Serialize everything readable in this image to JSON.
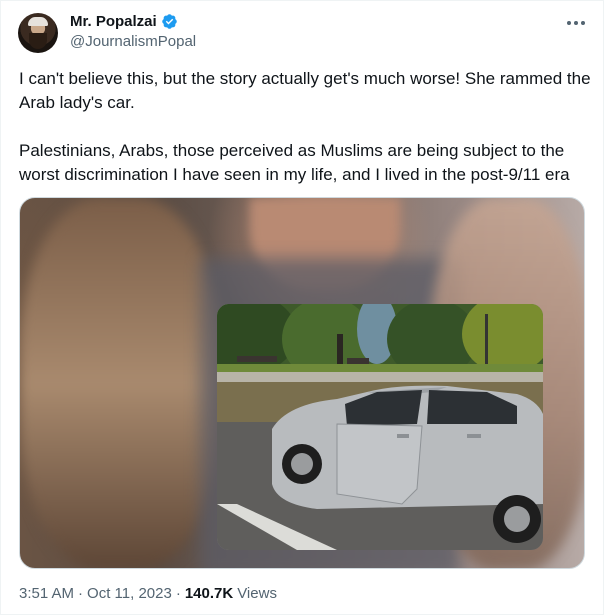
{
  "author": {
    "display_name": "Mr. Popalzai",
    "handle": "@JournalismPopal",
    "verified": true
  },
  "tweet": {
    "paragraphs": [
      "I can't believe this, but the story actually get's much worse! She rammed the Arab lady's car.",
      "Palestinians, Arabs, those perceived as Muslims are being subject to the worst discrimination I have seen in my life, and I lived in the post-9/11 era"
    ]
  },
  "meta": {
    "time": "3:51 AM",
    "separator": "·",
    "date": "Oct 11, 2023",
    "views_count": "140.7K",
    "views_label": "Views"
  },
  "icons": {
    "verified": "verified-badge-icon",
    "more": "more-options-icon"
  },
  "colors": {
    "accent": "#1d9bf0",
    "secondary_text": "#536471",
    "primary_text": "#0f1419"
  }
}
